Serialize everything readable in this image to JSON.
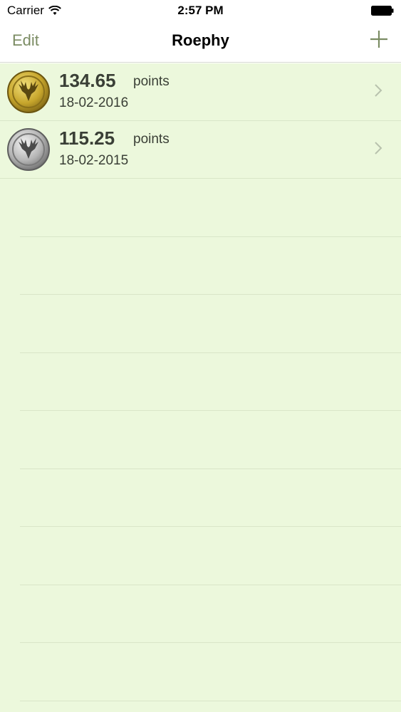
{
  "status_bar": {
    "carrier": "Carrier",
    "time": "2:57 PM",
    "wifi_icon": "wifi-icon",
    "battery_icon": "battery-icon"
  },
  "nav": {
    "left_label": "Edit",
    "title": "Roephy",
    "right_icon": "plus-icon"
  },
  "colors": {
    "accent": "#7b8c63",
    "list_background": "#ecf8dc",
    "separator": "#d9e6c8",
    "text": "#3a3f36",
    "gold_medal": "#c7a62c",
    "silver_medal": "#b5b5b5"
  },
  "trophies": [
    {
      "medal": "gold",
      "medal_icon": "gold-deer-medal-icon",
      "score": "134.65",
      "unit": "points",
      "date": "18-02-2016"
    },
    {
      "medal": "silver",
      "medal_icon": "silver-deer-medal-icon",
      "score": "115.25",
      "unit": "points",
      "date": "18-02-2015"
    }
  ]
}
